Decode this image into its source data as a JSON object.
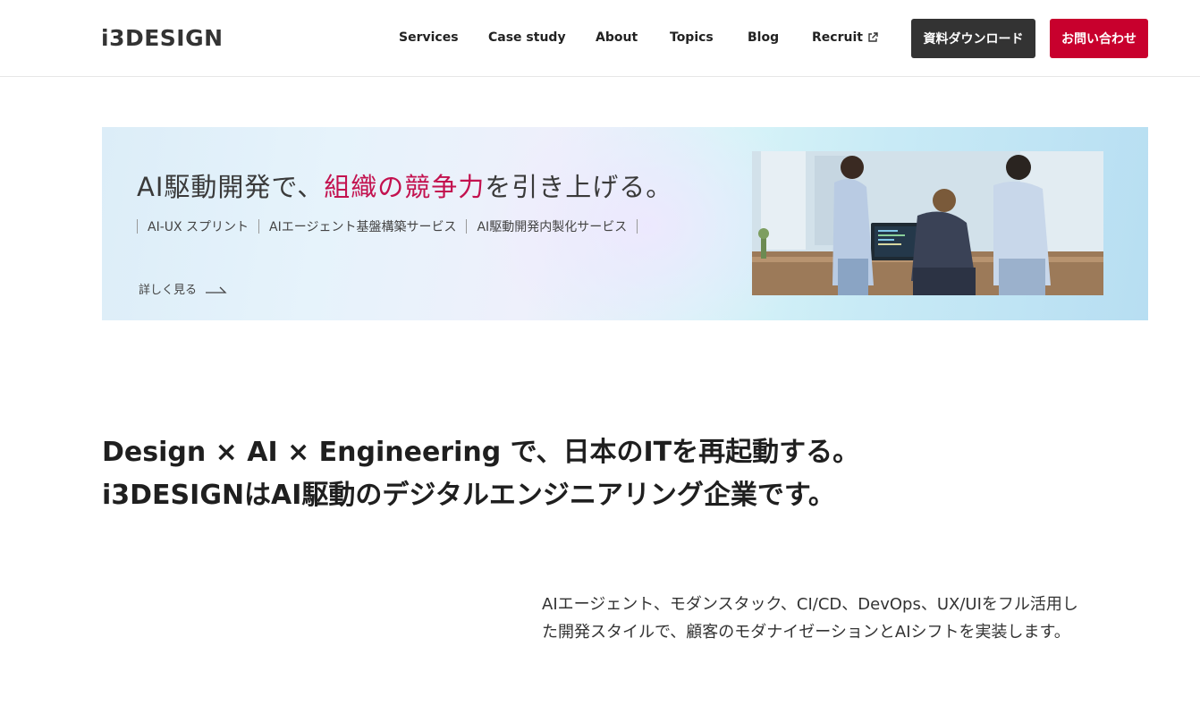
{
  "header": {
    "logo": "i3DESIGN",
    "nav": [
      {
        "label": "Services"
      },
      {
        "label": "Case study"
      },
      {
        "label": "About"
      },
      {
        "label": "Topics"
      },
      {
        "label": "Blog"
      },
      {
        "label": "Recruit",
        "icon": "external-link-icon"
      }
    ],
    "download_label": "資料ダウンロード",
    "contact_label": "お問い合わせ",
    "colors": {
      "download_bg": "#333333",
      "contact_bg": "#c8002d"
    }
  },
  "banner": {
    "title_pre": "AI駆動開発で、",
    "title_accent": "組織の競争力",
    "title_post": "を引き上げる。",
    "accent_color": "#c3124f",
    "services": [
      "AI-UX スプリント",
      "AIエージェント基盤構築サービス",
      "AI駆動開発内製化サービス"
    ],
    "more_label": "詳しく見る",
    "more_icon": "arrow-right-icon"
  },
  "main": {
    "headline_line1": "Design × AI × Engineering で、日本のITを再起動する。",
    "headline_line2": "i3DESIGNはAI駆動のデジタルエンジニアリング企業です。",
    "body_line1": "AIエージェント、モダンスタック、CI/CD、DevOps、UX/UIをフル活用し",
    "body_line2": "た開発スタイルで、顧客のモダナイゼーションとAIシフトを実装します。"
  }
}
